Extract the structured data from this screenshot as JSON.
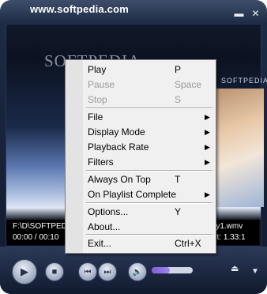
{
  "window": {
    "title": "www.softpedia.com",
    "minimize_glyph": "▬",
    "close_glyph": "✕"
  },
  "video": {
    "watermark": "SOFTPEDIA",
    "brand_text": "SOFTPEDIA"
  },
  "info": {
    "file_path": "F:\\D\\SOFTPEDI",
    "file_tail": "ry1.wmv",
    "time": "00:00 / 00:10",
    "aspect": "ect: 1.33:1"
  },
  "controls": {
    "play_glyph": "▶",
    "stop_glyph": "■",
    "prev_glyph": "⏮",
    "next_glyph": "⏭",
    "mute_glyph": "🔈",
    "eject_glyph": "⏏",
    "menu_glyph": "▼",
    "volume_level": 0.45
  },
  "context_menu": {
    "items": [
      {
        "label": "Play",
        "shortcut": "P",
        "disabled": false,
        "submenu": false
      },
      {
        "label": "Pause",
        "shortcut": "Space",
        "disabled": true,
        "submenu": false
      },
      {
        "label": "Stop",
        "shortcut": "S",
        "disabled": true,
        "submenu": false
      },
      {
        "label": "File",
        "shortcut": "",
        "disabled": false,
        "submenu": true
      },
      {
        "label": "Display Mode",
        "shortcut": "",
        "disabled": false,
        "submenu": true
      },
      {
        "label": "Playback Rate",
        "shortcut": "",
        "disabled": false,
        "submenu": true
      },
      {
        "label": "Filters",
        "shortcut": "",
        "disabled": false,
        "submenu": true
      },
      {
        "label": "Always On Top",
        "shortcut": "T",
        "disabled": false,
        "submenu": false
      },
      {
        "label": "On Playlist Complete",
        "shortcut": "",
        "disabled": false,
        "submenu": true
      },
      {
        "label": "Options...",
        "shortcut": "Y",
        "disabled": false,
        "submenu": false
      },
      {
        "label": "About...",
        "shortcut": "",
        "disabled": false,
        "submenu": false
      },
      {
        "label": "Exit...",
        "shortcut": "Ctrl+X",
        "disabled": false,
        "submenu": false
      }
    ],
    "submenu_arrow": "▶"
  }
}
